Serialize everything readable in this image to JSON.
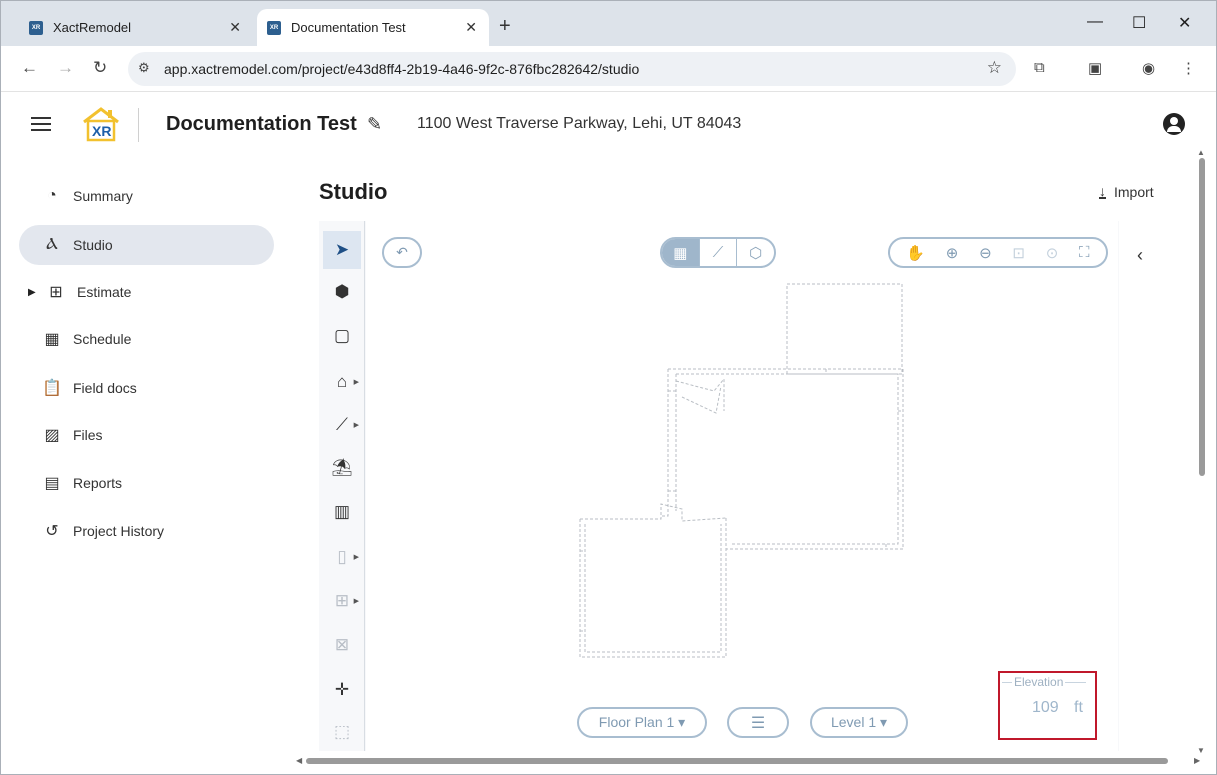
{
  "browser": {
    "tabs": [
      {
        "title": "XactRemodel",
        "favicon": "XR"
      },
      {
        "title": "Documentation Test",
        "favicon": "XR"
      }
    ],
    "new_tab": "+",
    "window_controls": {
      "minimize": "—",
      "maximize": "☐",
      "close": "✕"
    },
    "url": "app.xactremodel.com/project/e43d8ff4-2b19-4a46-9f2c-876fbc282642/studio"
  },
  "header": {
    "logo_text": "XR",
    "project_title": "Documentation Test",
    "address": "1100 West Traverse Parkway, Lehi, UT 84043"
  },
  "sidebar": {
    "items": [
      {
        "label": "Summary",
        "icon": "gauge-icon"
      },
      {
        "label": "Studio",
        "icon": "compass-icon"
      },
      {
        "label": "Estimate",
        "icon": "calculator-icon"
      },
      {
        "label": "Schedule",
        "icon": "calendar-icon"
      },
      {
        "label": "Field docs",
        "icon": "clipboard-plus-icon"
      },
      {
        "label": "Files",
        "icon": "images-icon"
      },
      {
        "label": "Reports",
        "icon": "document-icon"
      },
      {
        "label": "Project History",
        "icon": "history-icon"
      }
    ],
    "active": "Studio"
  },
  "studio": {
    "title": "Studio",
    "import_label": "Import",
    "floor_plan_label": "Floor Plan 1 ▾",
    "level_label": "Level 1 ▾",
    "elevation": {
      "label": "Elevation",
      "value": "109",
      "unit": "ft"
    }
  },
  "colors": {
    "accent": "#9fb6cb",
    "active_nav_bg": "#e3e7ee",
    "highlight_box": "#c0182b",
    "logo_yellow": "#f2c12e",
    "logo_blue": "#1d5fa8"
  }
}
